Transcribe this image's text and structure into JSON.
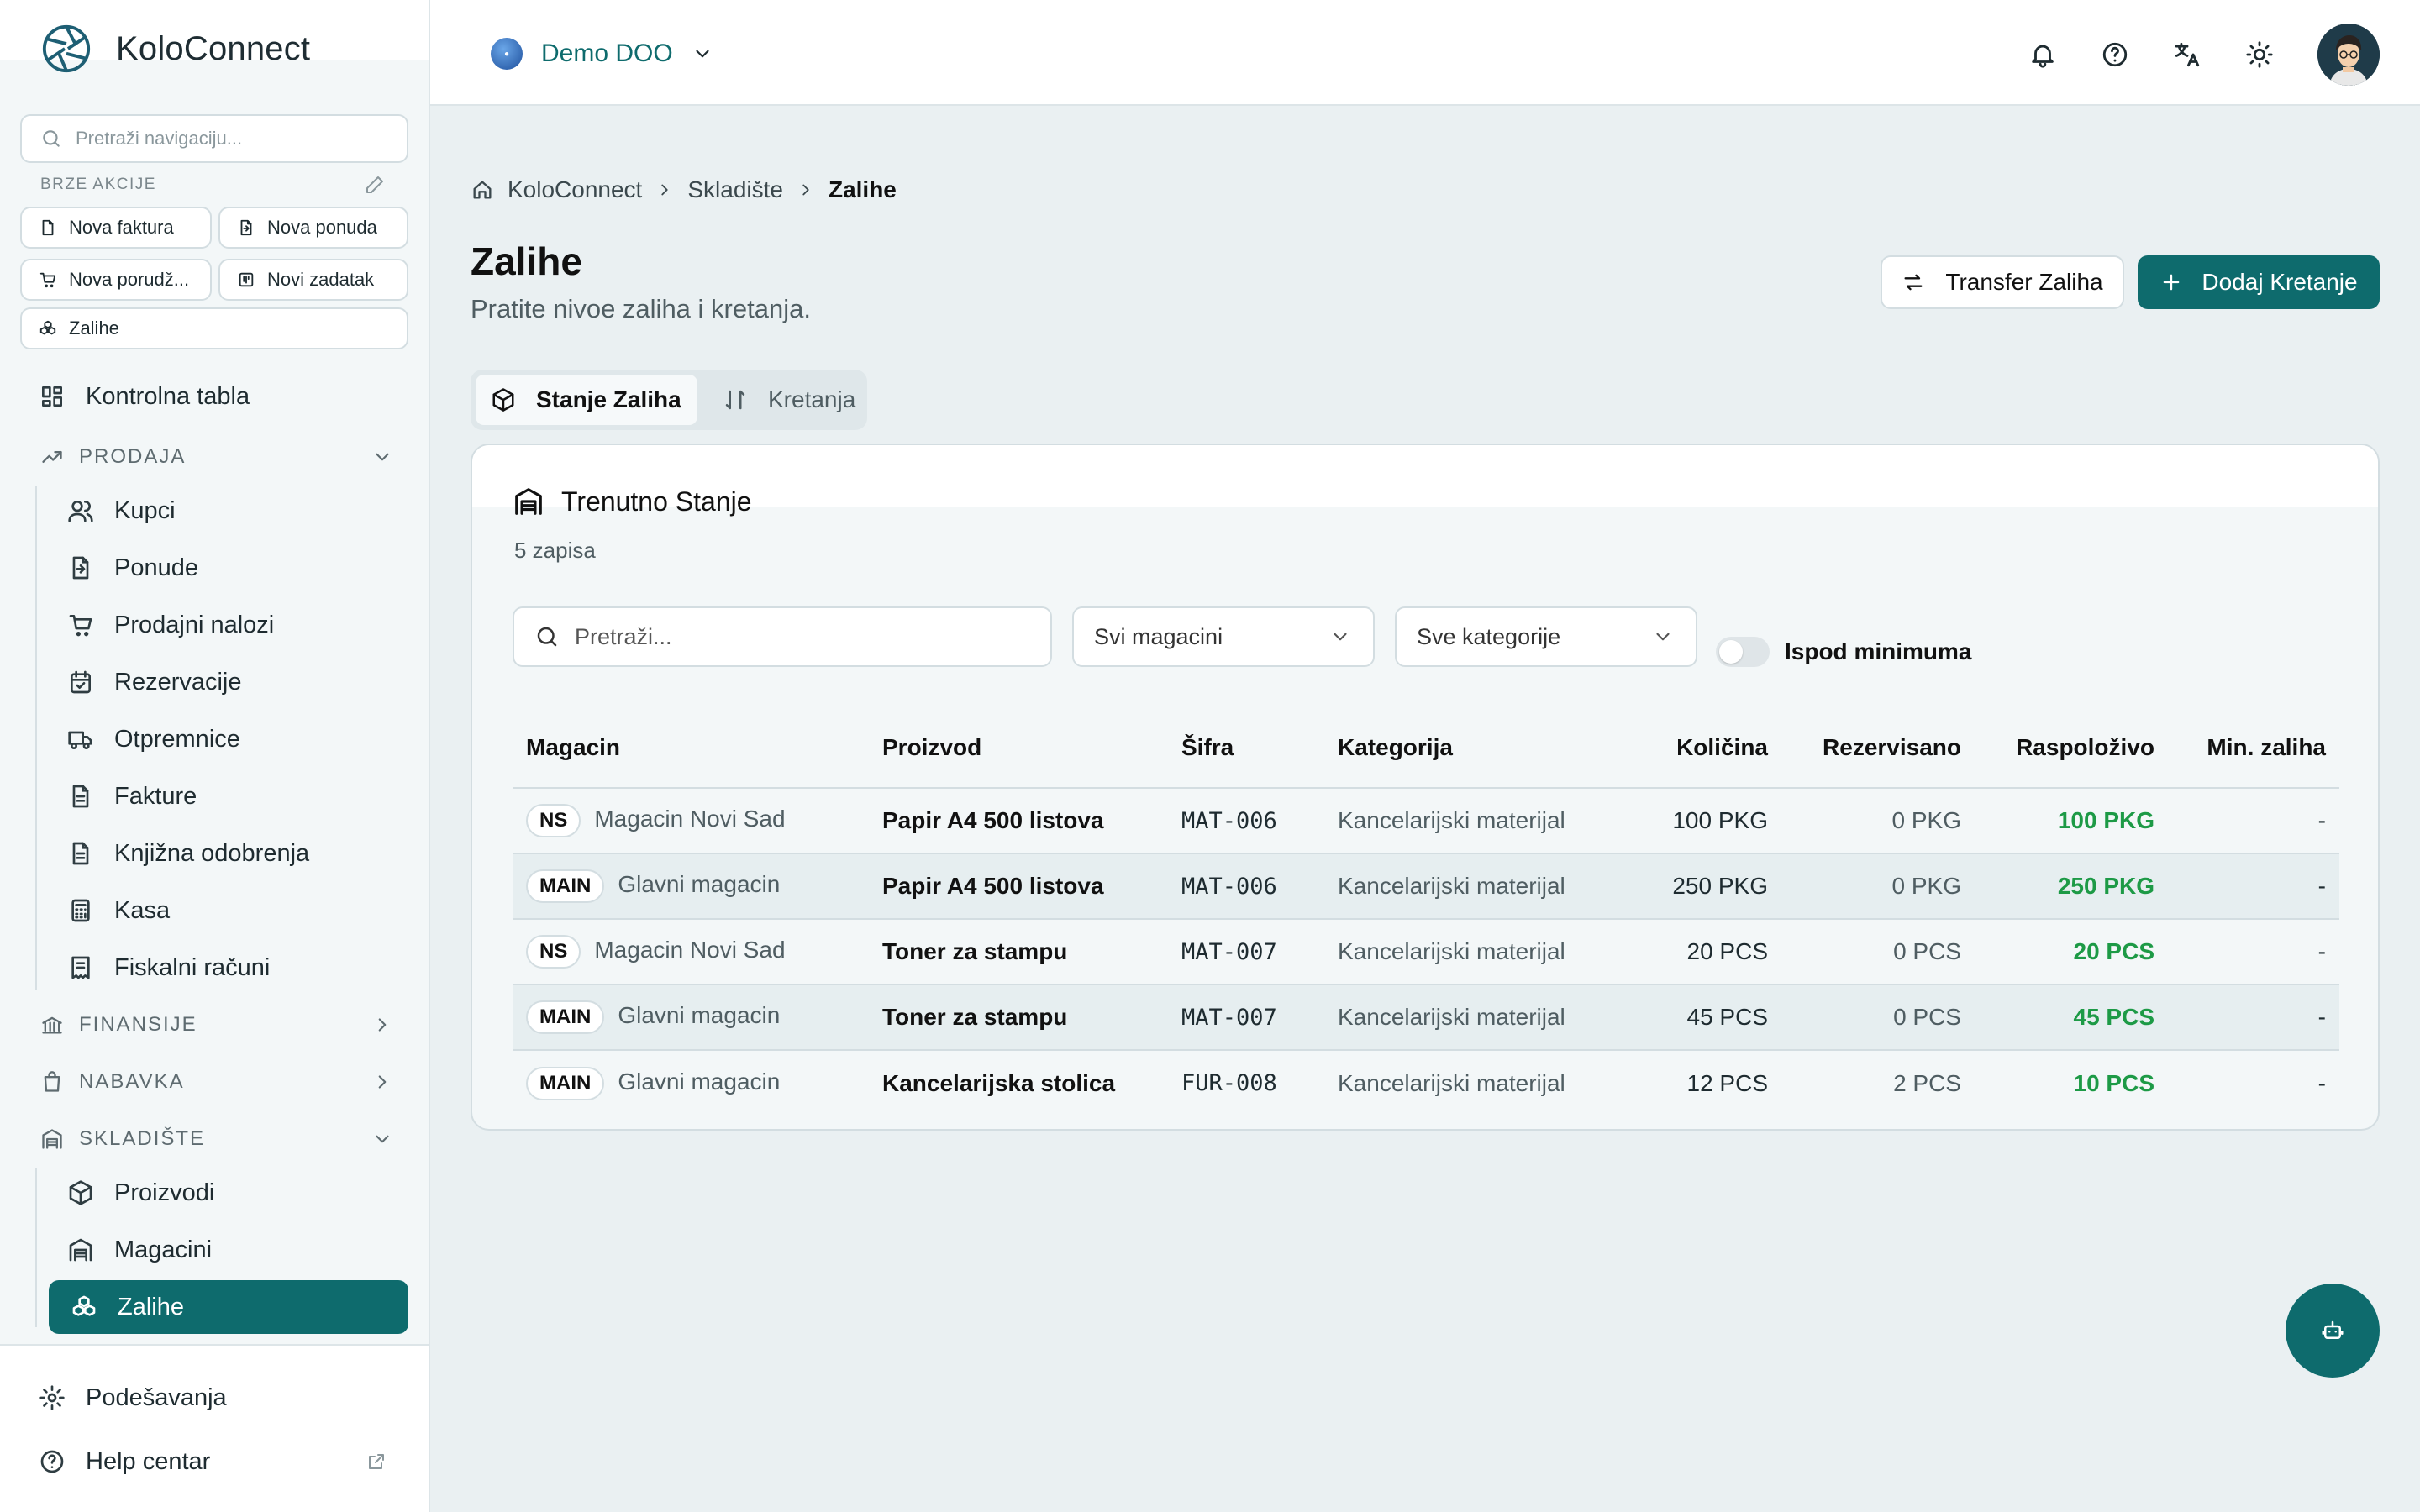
{
  "app": {
    "name": "KoloConnect"
  },
  "sidebar": {
    "search_placeholder": "Pretraži navigaciju...",
    "quick_actions_title": "BRZE AKCIJE",
    "quick_actions": [
      {
        "label": "Nova faktura",
        "icon": "file-invoice-icon"
      },
      {
        "label": "Nova ponuda",
        "icon": "file-quote-icon"
      },
      {
        "label": "Nova porudž...",
        "icon": "cart-icon"
      },
      {
        "label": "Novi zadatak",
        "icon": "kanban-icon"
      },
      {
        "label": "Zalihe",
        "icon": "boxes-icon"
      }
    ],
    "dashboard": "Kontrolna tabla",
    "sections": {
      "sales": "PRODAJA",
      "finance": "FINANSIJE",
      "procurement": "NABAVKA",
      "warehouse": "SKLADIŠTE"
    },
    "sales_items": [
      "Kupci",
      "Ponude",
      "Prodajni nalozi",
      "Rezervacije",
      "Otpremnice",
      "Fakture",
      "Knjižna odobrenja",
      "Kasa",
      "Fiskalni računi"
    ],
    "warehouse_items": [
      "Proizvodi",
      "Magacini",
      "Zalihe"
    ],
    "settings": "Podešavanja",
    "help": "Help centar"
  },
  "topbar": {
    "company": "Demo DOO"
  },
  "breadcrumb": [
    "KoloConnect",
    "Skladište",
    "Zalihe"
  ],
  "page": {
    "title": "Zalihe",
    "subtitle": "Pratite nivoe zaliha i kretanja.",
    "transfer_button": "Transfer Zaliha",
    "add_button": "Dodaj Kretanje"
  },
  "tabs": [
    {
      "label": "Stanje Zaliha",
      "active": true
    },
    {
      "label": "Kretanja",
      "active": false
    }
  ],
  "card": {
    "title": "Trenutno Stanje",
    "count": "5 zapisa",
    "search_placeholder": "Pretraži...",
    "warehouse_filter": "Svi magacini",
    "category_filter": "Sve kategorije",
    "below_min_label": "Ispod minimuma"
  },
  "table": {
    "columns": [
      "Magacin",
      "Proizvod",
      "Šifra",
      "Kategorija",
      "Količina",
      "Rezervisano",
      "Raspoloživo",
      "Min. zaliha"
    ],
    "rows": [
      {
        "code": "NS",
        "warehouse": "Magacin Novi Sad",
        "product": "Papir A4 500 listova",
        "sku": "MAT-006",
        "category": "Kancelarijski materijal",
        "qty": "100 PKG",
        "reserved": "0 PKG",
        "available": "100 PKG",
        "min": "-"
      },
      {
        "code": "MAIN",
        "warehouse": "Glavni magacin",
        "product": "Papir A4 500 listova",
        "sku": "MAT-006",
        "category": "Kancelarijski materijal",
        "qty": "250 PKG",
        "reserved": "0 PKG",
        "available": "250 PKG",
        "min": "-"
      },
      {
        "code": "NS",
        "warehouse": "Magacin Novi Sad",
        "product": "Toner za stampu",
        "sku": "MAT-007",
        "category": "Kancelarijski materijal",
        "qty": "20 PCS",
        "reserved": "0 PCS",
        "available": "20 PCS",
        "min": "-"
      },
      {
        "code": "MAIN",
        "warehouse": "Glavni magacin",
        "product": "Toner za stampu",
        "sku": "MAT-007",
        "category": "Kancelarijski materijal",
        "qty": "45 PCS",
        "reserved": "0 PCS",
        "available": "45 PCS",
        "min": "-"
      },
      {
        "code": "MAIN",
        "warehouse": "Glavni magacin",
        "product": "Kancelarijska stolica",
        "sku": "FUR-008",
        "category": "Kancelarijski materijal",
        "qty": "12 PCS",
        "reserved": "2 PCS",
        "available": "10 PCS",
        "min": "-"
      }
    ]
  },
  "colors": {
    "primary": "#0e6b6d",
    "available_green": "#1d9a46"
  }
}
